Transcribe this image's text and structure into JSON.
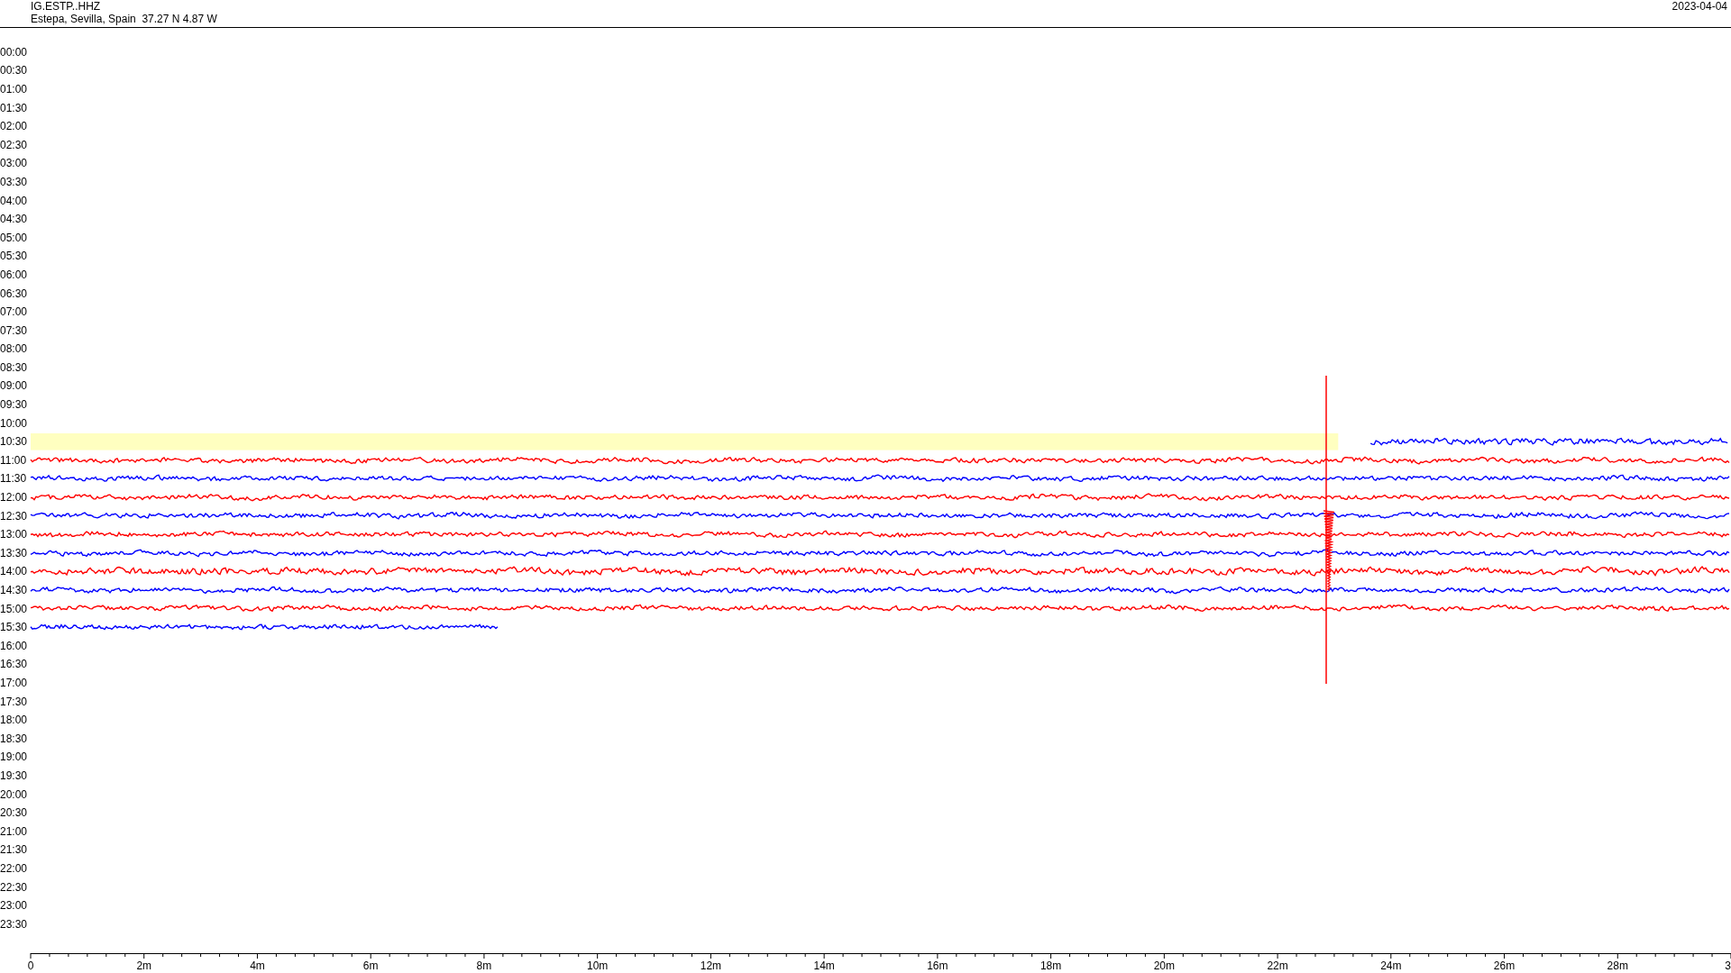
{
  "header": {
    "station": "IG.ESTP..HHZ",
    "location": "Estepa, Sevilla, Spain  37.27 N 4.87 W",
    "date": "2023-04-04"
  },
  "rows": [
    {
      "time": "00:00"
    },
    {
      "time": "00:30"
    },
    {
      "time": "01:00"
    },
    {
      "time": "01:30"
    },
    {
      "time": "02:00"
    },
    {
      "time": "02:30"
    },
    {
      "time": "03:00"
    },
    {
      "time": "03:30"
    },
    {
      "time": "04:00"
    },
    {
      "time": "04:30"
    },
    {
      "time": "05:00"
    },
    {
      "time": "05:30"
    },
    {
      "time": "06:00"
    },
    {
      "time": "06:30"
    },
    {
      "time": "07:00"
    },
    {
      "time": "07:30"
    },
    {
      "time": "08:00"
    },
    {
      "time": "08:30"
    },
    {
      "time": "09:00"
    },
    {
      "time": "09:30"
    },
    {
      "time": "10:00"
    },
    {
      "time": "10:30",
      "trace": {
        "kind": "current",
        "color": "#0000ff"
      }
    },
    {
      "time": "11:00",
      "trace": {
        "kind": "full",
        "color": "#ff0000"
      }
    },
    {
      "time": "11:30",
      "trace": {
        "kind": "full",
        "color": "#0000ff"
      }
    },
    {
      "time": "12:00",
      "trace": {
        "kind": "full",
        "color": "#ff0000"
      }
    },
    {
      "time": "12:30",
      "trace": {
        "kind": "full",
        "color": "#0000ff"
      }
    },
    {
      "time": "13:00",
      "trace": {
        "kind": "full",
        "color": "#ff0000"
      }
    },
    {
      "time": "13:30",
      "trace": {
        "kind": "full",
        "color": "#0000ff"
      }
    },
    {
      "time": "14:00",
      "trace": {
        "kind": "full",
        "color": "#ff0000"
      }
    },
    {
      "time": "14:30",
      "trace": {
        "kind": "full",
        "color": "#0000ff"
      }
    },
    {
      "time": "15:00",
      "trace": {
        "kind": "full",
        "color": "#ff0000"
      }
    },
    {
      "time": "15:30",
      "trace": {
        "kind": "partial",
        "color": "#0000ff"
      }
    },
    {
      "time": "16:00"
    },
    {
      "time": "16:30"
    },
    {
      "time": "17:00"
    },
    {
      "time": "17:30"
    },
    {
      "time": "18:00"
    },
    {
      "time": "18:30"
    },
    {
      "time": "19:00"
    },
    {
      "time": "19:30"
    },
    {
      "time": "20:00"
    },
    {
      "time": "20:30"
    },
    {
      "time": "21:00"
    },
    {
      "time": "21:30"
    },
    {
      "time": "22:00"
    },
    {
      "time": "22:30"
    },
    {
      "time": "23:00"
    },
    {
      "time": "23:30"
    }
  ],
  "axis": {
    "labels": [
      "0",
      "2m",
      "4m",
      "6m",
      "8m",
      "10m",
      "12m",
      "14m",
      "16m",
      "18m",
      "20m",
      "22m",
      "24m",
      "26m",
      "28m",
      "3"
    ]
  }
}
